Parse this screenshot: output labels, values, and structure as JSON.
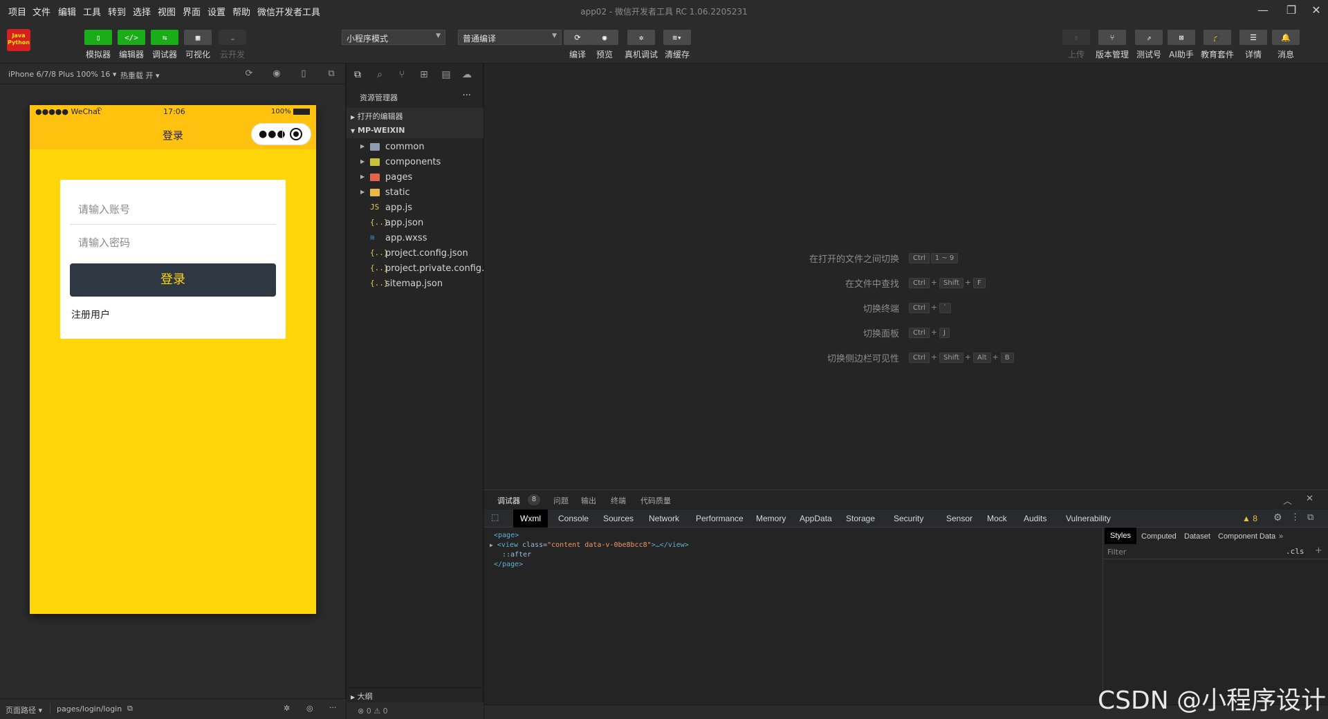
{
  "menu": [
    "项目",
    "文件",
    "编辑",
    "工具",
    "转到",
    "选择",
    "视图",
    "界面",
    "设置",
    "帮助",
    "微信开发者工具"
  ],
  "window_title": "app02 - 微信开发者工具 RC 1.06.2205231",
  "logo_text": [
    "Java",
    "Python"
  ],
  "toolbar": {
    "left_buttons": [
      {
        "label": "模拟器",
        "icon": "phone-icon"
      },
      {
        "label": "编辑器",
        "icon": "code-icon"
      },
      {
        "label": "调试器",
        "icon": "debug-icon"
      },
      {
        "label": "可视化",
        "icon": "layout-icon"
      },
      {
        "label": "云开发",
        "icon": "cloud-icon"
      }
    ],
    "mode_select": "小程序模式",
    "compile_select": "普通编译",
    "center_buttons": [
      {
        "label": "编译",
        "icon": "refresh-icon"
      },
      {
        "label": "预览",
        "icon": "eye-icon"
      },
      {
        "label": "真机调试",
        "icon": "bug-icon"
      },
      {
        "label": "清缓存",
        "icon": "layers-icon"
      }
    ],
    "right_buttons": [
      {
        "label": "上传",
        "icon": "upload-icon"
      },
      {
        "label": "版本管理",
        "icon": "branch-icon"
      },
      {
        "label": "测试号",
        "icon": "external-icon"
      },
      {
        "label": "AI助手",
        "icon": "ai-icon"
      },
      {
        "label": "教育套件",
        "icon": "graduation-icon"
      },
      {
        "label": "详情",
        "icon": "menu-icon"
      },
      {
        "label": "消息",
        "icon": "bell-icon"
      }
    ]
  },
  "simulator": {
    "device": "iPhone 6/7/8 Plus 100% 16 ▾",
    "hot_reload": "热重载 开 ▾",
    "status_carrier": "●●●●● WeChat",
    "status_time": "17:06",
    "status_battery": "100%",
    "nav_title": "登录",
    "account_placeholder": "请输入账号",
    "password_placeholder": "请输入密码",
    "login_button": "登录",
    "register_link": "注册用户",
    "footer_path_label": "页面路径 ▾",
    "footer_path": "pages/login/login"
  },
  "explorer": {
    "header": "资源管理器",
    "more": "···",
    "open_editors": "打开的编辑器",
    "project": "MP-WEIXIN",
    "folders": [
      {
        "name": "common",
        "color": "#8c9bb0"
      },
      {
        "name": "components",
        "color": "#c9c23a"
      },
      {
        "name": "pages",
        "color": "#e2644f"
      },
      {
        "name": "static",
        "color": "#e8b84a"
      }
    ],
    "files": [
      {
        "name": "app.js",
        "glyph": "JS",
        "color": "#e8c84a"
      },
      {
        "name": "app.json",
        "glyph": "{..}",
        "color": "#e8c84a"
      },
      {
        "name": "app.wxss",
        "glyph": "≋",
        "color": "#3a9ad9"
      },
      {
        "name": "project.config.json",
        "glyph": "{..}",
        "color": "#e8c84a"
      },
      {
        "name": "project.private.config.js...",
        "glyph": "{..}",
        "color": "#e8c84a"
      },
      {
        "name": "sitemap.json",
        "glyph": "{..}",
        "color": "#e8c84a"
      }
    ],
    "outline": "大纲",
    "status": "⊗ 0 ⚠ 0"
  },
  "editor_hints": [
    {
      "label": "在打开的文件之间切换",
      "keys": [
        "Ctrl",
        "1 ~ 9"
      ]
    },
    {
      "label": "在文件中查找",
      "keys": [
        "Ctrl",
        "+",
        "Shift",
        "+",
        "F"
      ]
    },
    {
      "label": "切换终端",
      "keys": [
        "Ctrl",
        "+",
        "`"
      ]
    },
    {
      "label": "切换面板",
      "keys": [
        "Ctrl",
        "+",
        "J"
      ]
    },
    {
      "label": "切换侧边栏可见性",
      "keys": [
        "Ctrl",
        "+",
        "Shift",
        "+",
        "Alt",
        "+",
        "B"
      ]
    }
  ],
  "debugger": {
    "tabs": [
      "调试器",
      "问题",
      "输出",
      "终端",
      "代码质量"
    ],
    "badge": "8",
    "devtools_tabs": [
      "Wxml",
      "Console",
      "Sources",
      "Network",
      "Performance",
      "Memory",
      "AppData",
      "Storage",
      "Security",
      "Sensor",
      "Mock",
      "Audits",
      "Vulnerability"
    ],
    "warnings": "▲ 8",
    "wxml": {
      "page_open": "<page>",
      "view_open": "<view",
      "class_attr": "class=",
      "class_val": "\"content data-v-0be8bcc8\"",
      "view_close": ">…</view>",
      "after": "::after",
      "page_close": "</page>"
    },
    "style_tabs": [
      "Styles",
      "Computed",
      "Dataset",
      "Component Data"
    ],
    "filter_placeholder": "Filter",
    "cls": ".cls",
    "plus": "+"
  },
  "watermark": "CSDN @小程序设计"
}
